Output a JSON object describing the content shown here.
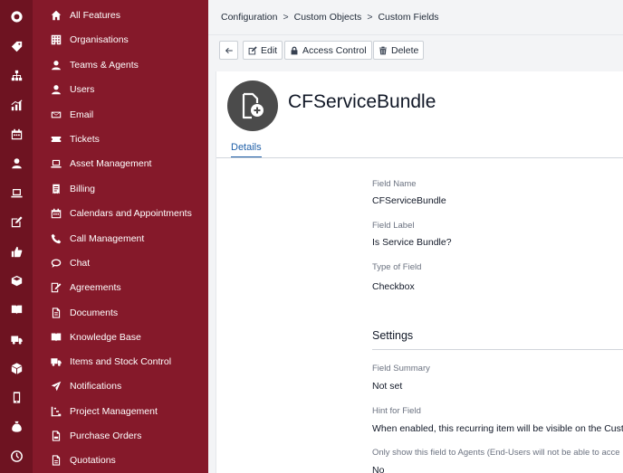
{
  "rail": {
    "icons": [
      "logo-icon",
      "tag-icon",
      "hierarchy-icon",
      "chart-icon",
      "calendar-icon",
      "user-icon",
      "laptop-icon",
      "edit-icon",
      "thumbs-up-icon",
      "box-icon",
      "book-icon",
      "truck-icon",
      "package-icon",
      "mobile-icon",
      "money-bag-icon",
      "clock-icon"
    ]
  },
  "sidebar": {
    "items": [
      {
        "label": "All Features",
        "icon": "home-icon"
      },
      {
        "label": "Organisations",
        "icon": "building-icon"
      },
      {
        "label": "Teams & Agents",
        "icon": "user-icon"
      },
      {
        "label": "Users",
        "icon": "user-icon"
      },
      {
        "label": "Email",
        "icon": "email-icon"
      },
      {
        "label": "Tickets",
        "icon": "ticket-icon"
      },
      {
        "label": "Asset Management",
        "icon": "laptop-icon"
      },
      {
        "label": "Billing",
        "icon": "billing-icon"
      },
      {
        "label": "Calendars and Appointments",
        "icon": "calendar-icon"
      },
      {
        "label": "Call Management",
        "icon": "phone-icon"
      },
      {
        "label": "Chat",
        "icon": "chat-icon"
      },
      {
        "label": "Agreements",
        "icon": "agreement-icon"
      },
      {
        "label": "Documents",
        "icon": "document-icon"
      },
      {
        "label": "Knowledge Base",
        "icon": "knowledge-icon"
      },
      {
        "label": "Items and Stock Control",
        "icon": "stock-icon"
      },
      {
        "label": "Notifications",
        "icon": "notification-icon"
      },
      {
        "label": "Project Management",
        "icon": "project-icon"
      },
      {
        "label": "Purchase Orders",
        "icon": "purchase-order-icon"
      },
      {
        "label": "Quotations",
        "icon": "quotation-icon"
      }
    ]
  },
  "breadcrumb": {
    "items": [
      "Configuration",
      "Custom Objects",
      "Custom Fields"
    ],
    "separator": ">"
  },
  "toolbar": {
    "back_icon": "arrow-left-icon",
    "edit_label": "Edit",
    "access_label": "Access Control",
    "delete_label": "Delete"
  },
  "record": {
    "title": "CFServiceBundle",
    "tab": "Details",
    "fields": [
      {
        "label": "Field Name",
        "value": "CFServiceBundle"
      },
      {
        "label": "Field Label",
        "value": "Is Service Bundle?"
      },
      {
        "label": "Type of Field",
        "value": "Checkbox"
      }
    ],
    "settings_title": "Settings",
    "settings": [
      {
        "label": "Field Summary",
        "value": "Not set"
      },
      {
        "label": "Hint for Field",
        "value": "When enabled, this recurring item will be visible on the Cust"
      },
      {
        "label": "Only show this field to Agents (End-Users will not be able to acce",
        "value": "No"
      }
    ]
  },
  "colors": {
    "rail": "#6e1321",
    "sidebar": "#85192a",
    "accent": "#1f5fa8"
  }
}
